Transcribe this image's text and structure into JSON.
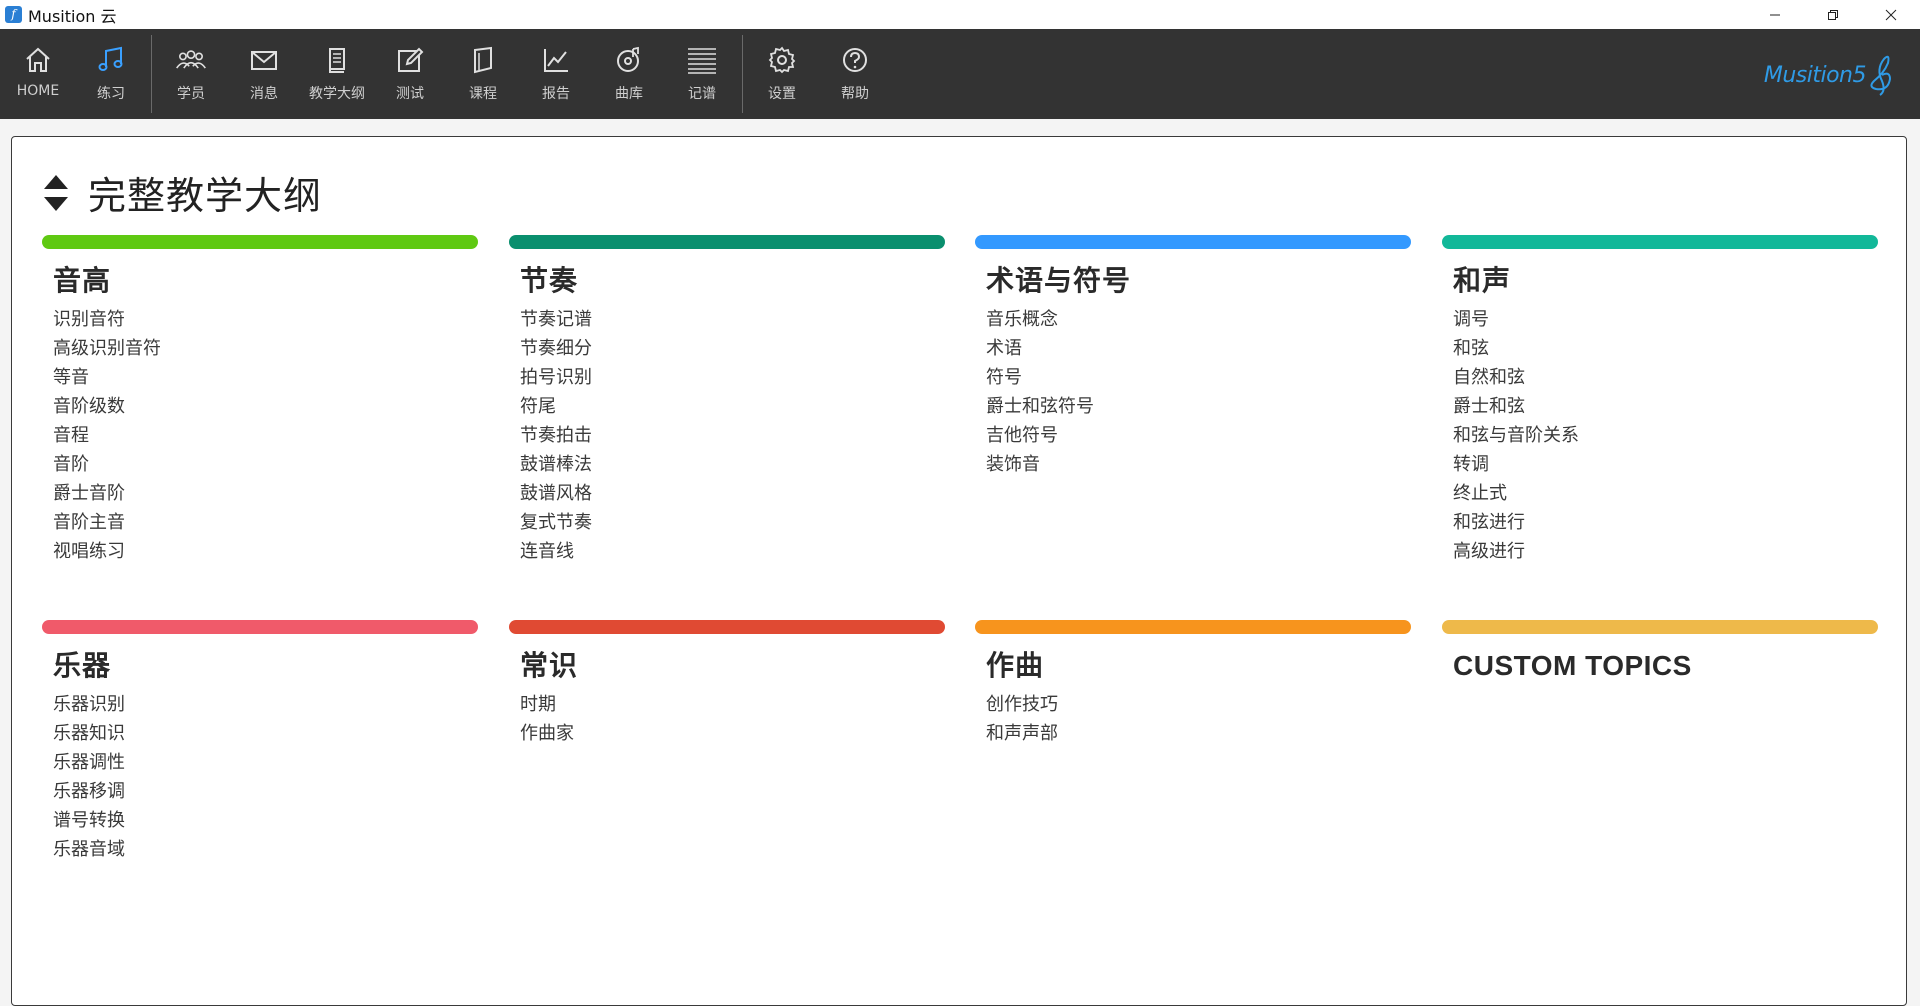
{
  "window": {
    "title": "Musition 云",
    "app_icon_glyph": "f"
  },
  "toolbar": {
    "items": [
      {
        "label": "HOME",
        "icon": "home-icon"
      },
      {
        "label": "练习",
        "icon": "music-note-icon",
        "active": true
      },
      {
        "label": "学员",
        "icon": "users-icon"
      },
      {
        "label": "消息",
        "icon": "mail-icon"
      },
      {
        "label": "教学大纲",
        "icon": "book-icon"
      },
      {
        "label": "测试",
        "icon": "edit-icon"
      },
      {
        "label": "课程",
        "icon": "course-book-icon"
      },
      {
        "label": "报告",
        "icon": "chart-line-icon"
      },
      {
        "label": "曲库",
        "icon": "music-disc-icon"
      },
      {
        "label": "记谱",
        "icon": "staff-lines-icon"
      },
      {
        "label": "设置",
        "icon": "gear-icon"
      },
      {
        "label": "帮助",
        "icon": "help-icon"
      }
    ],
    "brand": "Musition5",
    "active_color": "#3aa0ff"
  },
  "page": {
    "title": "完整教学大纲"
  },
  "categories": [
    {
      "title": "音高",
      "color": "#5fc912",
      "items": [
        "识别音符",
        "高级识别音符",
        "等音",
        "音阶级数",
        "音程",
        "音阶",
        "爵士音阶",
        "音阶主音",
        "视唱练习"
      ]
    },
    {
      "title": "节奏",
      "color": "#0a8f6e",
      "items": [
        "节奏记谱",
        "节奏细分",
        "拍号识别",
        "符尾",
        "节奏拍击",
        "鼓谱棒法",
        "鼓谱风格",
        "复式节奏",
        "连音线"
      ]
    },
    {
      "title": "术语与符号",
      "color": "#3399ff",
      "items": [
        "音乐概念",
        "术语",
        "符号",
        "爵士和弦符号",
        "吉他符号",
        "装饰音"
      ]
    },
    {
      "title": "和声",
      "color": "#12b899",
      "items": [
        "调号",
        "和弦",
        "自然和弦",
        "爵士和弦",
        "和弦与音阶关系",
        "转调",
        "终止式",
        "和弦进行",
        "高级进行"
      ]
    },
    {
      "title": "乐器",
      "color": "#f05a6a",
      "items": [
        "乐器识别",
        "乐器知识",
        "乐器调性",
        "乐器移调",
        "谱号转换",
        "乐器音域"
      ]
    },
    {
      "title": "常识",
      "color": "#e04a33",
      "items": [
        "时期",
        "作曲家"
      ]
    },
    {
      "title": "作曲",
      "color": "#f7941d",
      "items": [
        "创作技巧",
        "和声声部"
      ]
    },
    {
      "title": "CUSTOM TOPICS",
      "color": "#eeb94a",
      "items": []
    }
  ]
}
